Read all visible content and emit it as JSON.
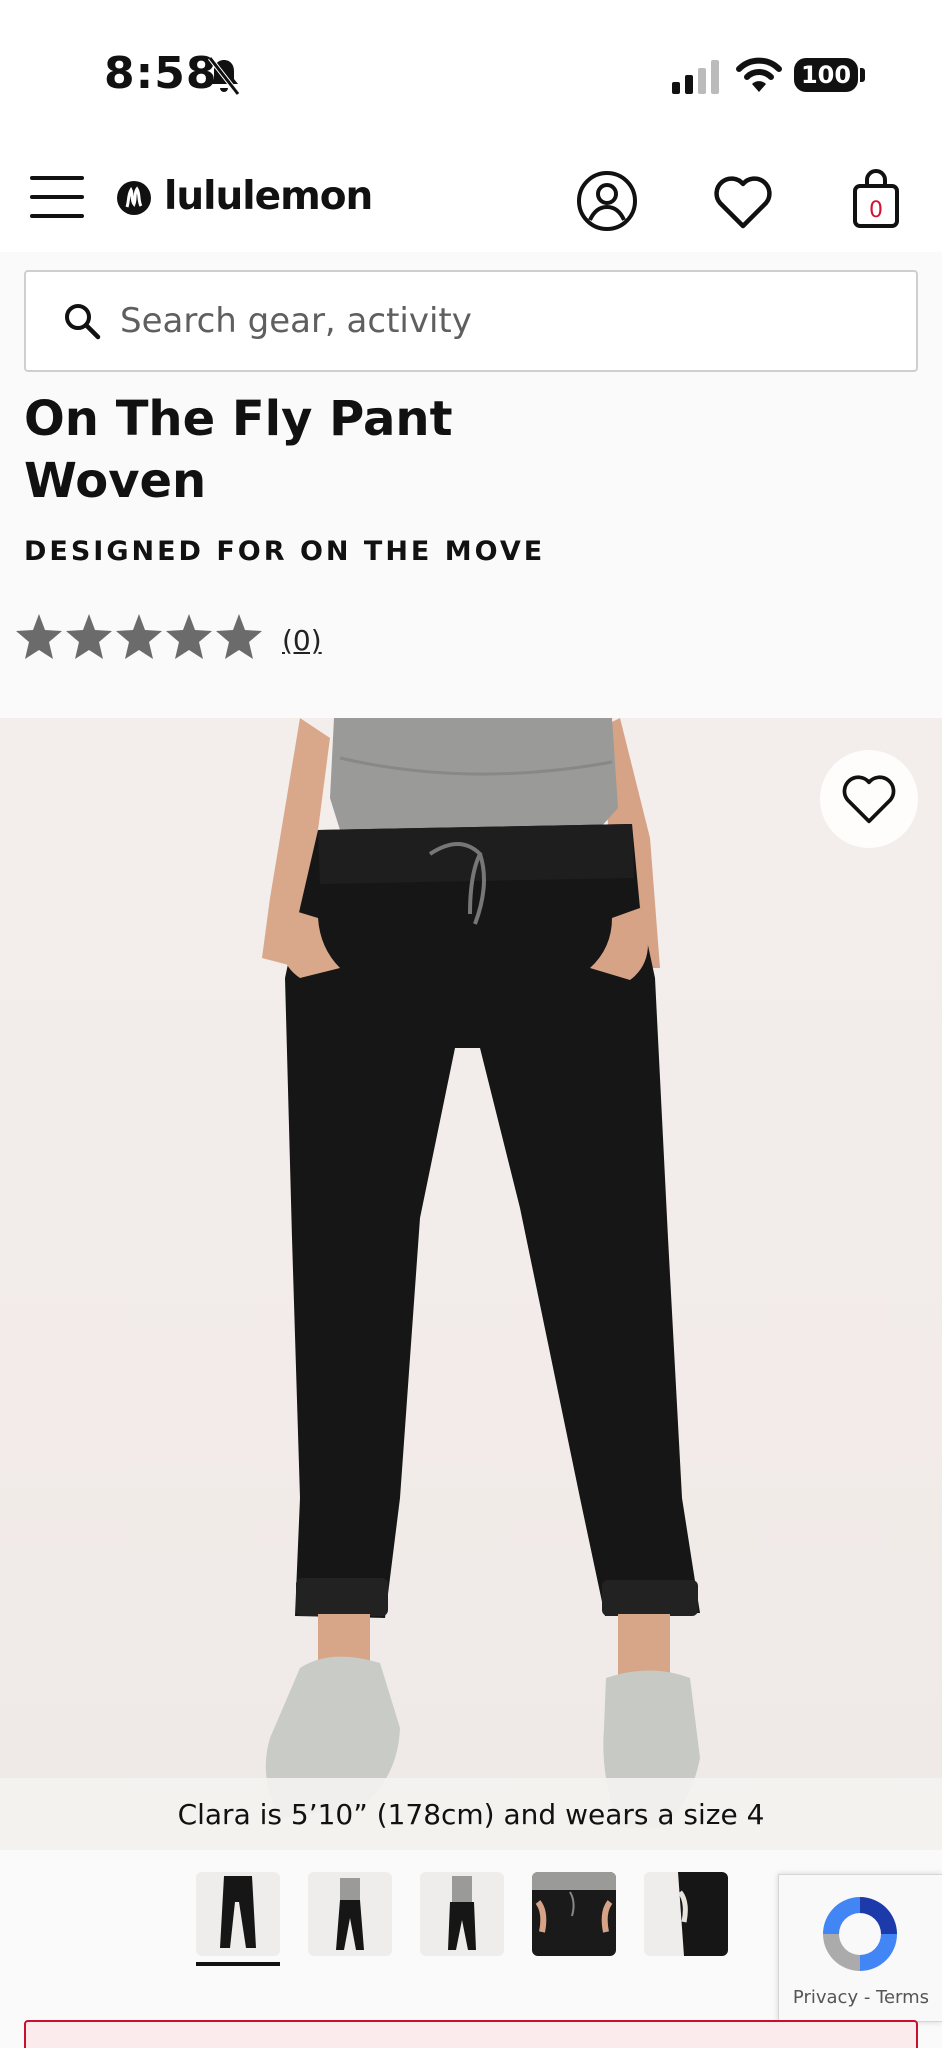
{
  "status_bar": {
    "time": "8:58",
    "battery": "100",
    "icons": [
      "bell-slash-icon",
      "signal-icon",
      "wifi-icon",
      "battery-icon"
    ]
  },
  "header": {
    "brand": "lululemon",
    "bag_count": "0",
    "icons": [
      "menu-icon",
      "logo-mark-icon",
      "account-icon",
      "heart-icon",
      "bag-icon"
    ]
  },
  "search": {
    "placeholder": "Search gear, activity"
  },
  "product": {
    "title": "On The Fly Pant Woven",
    "tagline": "DESIGNED FOR ON THE MOVE",
    "rating_out_of_5": 0,
    "review_count": "(0)",
    "model_caption": "Clara is 5’10” (178cm) and wears a size 4",
    "thumbnail_count": 5,
    "selected_thumbnail": 1
  },
  "recaptcha": {
    "privacy": "Privacy",
    "separator": " - ",
    "terms": "Terms"
  },
  "colors": {
    "text": "#111111",
    "star": "#6b6b6b",
    "brand_red": "#c8102e",
    "pant_black": "#161616"
  }
}
